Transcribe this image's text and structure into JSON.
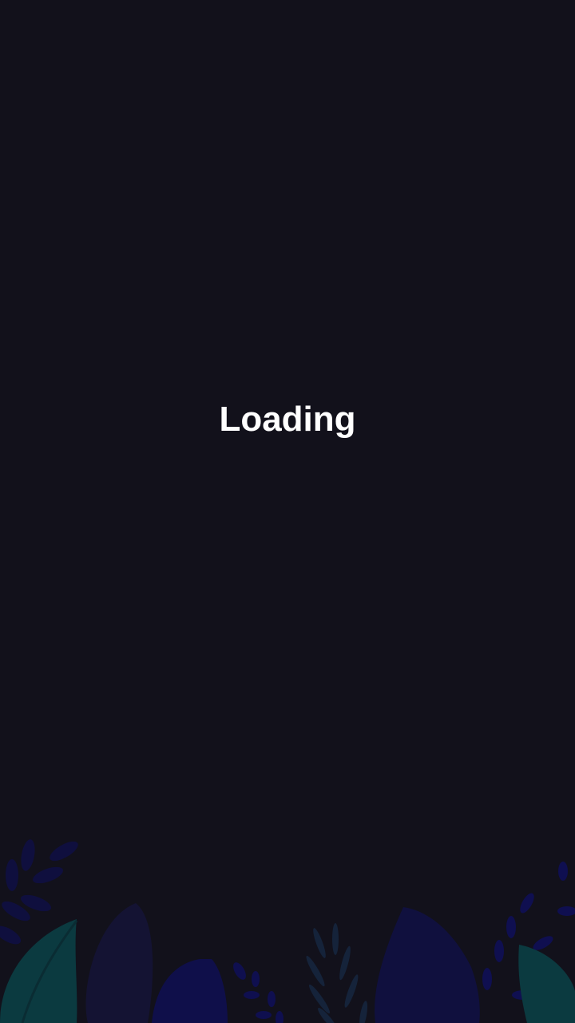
{
  "status": {
    "loading_label": "Loading"
  },
  "colors": {
    "background": "#12111b",
    "text": "#ffffff",
    "leaf_teal": "#0b3a40",
    "leaf_blue": "#0e0f4a"
  }
}
